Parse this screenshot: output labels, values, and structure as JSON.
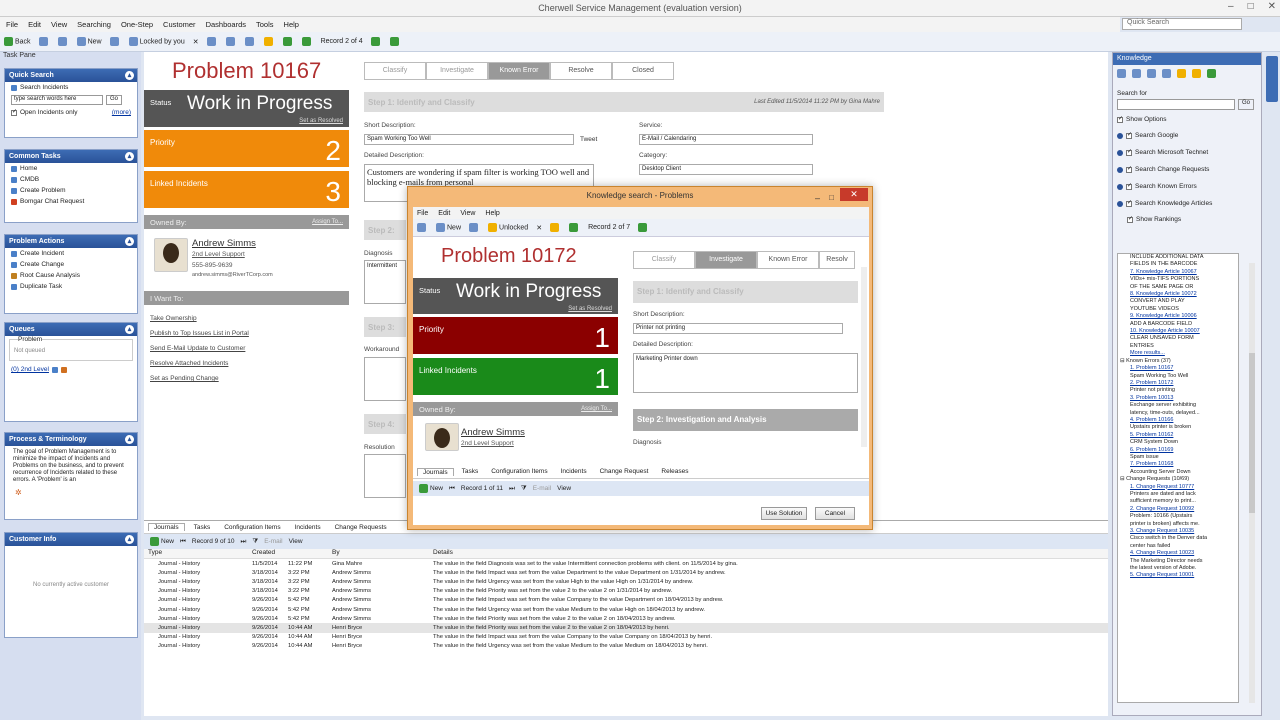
{
  "window": {
    "title": "Cherwell Service Management (evaluation version)",
    "quick_search_placeholder": "Quick Search"
  },
  "menu": [
    "File",
    "Edit",
    "View",
    "Searching",
    "One-Step",
    "Customer",
    "Dashboards",
    "Tools",
    "Help"
  ],
  "toolbar": {
    "back": "Back",
    "new": "New",
    "locked": "Locked by you",
    "record": "Record 2 of 4"
  },
  "task_pane": {
    "title": "Task Pane",
    "quick_search": {
      "header": "Quick Search",
      "label": "Search Incidents",
      "input": "type search words here",
      "go": "Go",
      "checkbox": "Open Incidents only",
      "more": "(more)"
    },
    "common_tasks": {
      "header": "Common Tasks",
      "items": [
        "Home",
        "CMDB",
        "Create Problem",
        "Bomgar Chat Request"
      ]
    },
    "problem_actions": {
      "header": "Problem Actions",
      "items": [
        "Create Incident",
        "Create Change",
        "Root Cause Analysis",
        "Duplicate Task"
      ]
    },
    "queues": {
      "header": "Queues",
      "label": "Problem",
      "placeholder": "Not queued",
      "link": "(0) 2nd Level"
    },
    "process": {
      "header": "Process & Terminology",
      "text": "The goal of Problem Management is to minimize the impact of Incidents and Problems on the business, and to prevent recurrence of Incidents related to these errors. A 'Problem' is an"
    },
    "customer": {
      "header": "Customer Info",
      "text": "No currently active customer"
    }
  },
  "record": {
    "title": "Problem  10167",
    "status_label": "Status",
    "status": "Work in Progress",
    "set_resolved": "Set as Resolved",
    "priority_label": "Priority",
    "priority": "2",
    "linked_label": "Linked Incidents",
    "linked": "3",
    "owned_label": "Owned By:",
    "assign": "Assign To...",
    "owner_name": "Andrew Simms",
    "owner_team": "2nd Level Support",
    "owner_phone": "555-895-9639",
    "owner_email": "andrew.simms@RiverTCorp.com",
    "i_want": "I Want To:",
    "actions": [
      "Take Ownership",
      "Publish to Top Issues List in Portal",
      "Send E-Mail Update to Customer",
      "Resolve Attached Incidents",
      "Set as Pending Change"
    ],
    "steps": [
      "Classify",
      "Investigate",
      "Known Error",
      "Resolve",
      "Closed"
    ],
    "step1": "Step 1: Identify and Classify",
    "last_edited": "Last Edited 11/5/2014 11:22 PM by Gina Mahre",
    "short_desc_label": "Short Description:",
    "short_desc": "Spam Working Too Well",
    "tweet": "Tweet",
    "service_label": "Service:",
    "service": "E-Mail / Calendaring",
    "detailed_label": "Detailed Description:",
    "detailed": "Customers are wondering if spam filter is working TOO well and blocking e-mails from personal",
    "category_label": "Category:",
    "category": "Desktop Client",
    "step2": "Step 2:",
    "diagnosis_label": "Diagnosis",
    "diagnosis": "Intermittent",
    "step3": "Step 3:",
    "workaround_label": "Workaround",
    "step4": "Step 4:",
    "resolution_label": "Resolution"
  },
  "bottom": {
    "tabs": [
      "Journals",
      "Tasks",
      "Configuration Items",
      "Incidents",
      "Change Requests"
    ],
    "new": "New",
    "record": "Record 9 of 10",
    "email": "E-mail",
    "view": "View",
    "columns": [
      "Type",
      "Created",
      "By",
      "Details"
    ],
    "rows": [
      [
        "Journal - History",
        "11/5/2014",
        "11:22 PM",
        "Gina Mahre",
        "The value in the field Diagnosis was set to the value Intermittent connection problems with client. on 11/5/2014 by gina."
      ],
      [
        "Journal - History",
        "3/18/2014",
        "3:22 PM",
        "Andrew Simms",
        "The value in the field Impact was set from the value Department to the value Department on 1/31/2014 by andrew."
      ],
      [
        "Journal - History",
        "3/18/2014",
        "3:22 PM",
        "Andrew Simms",
        "The value in the field Urgency was set from the value High to the value High on 1/31/2014 by andrew."
      ],
      [
        "Journal - History",
        "3/18/2014",
        "3:22 PM",
        "Andrew Simms",
        "The value in the field Priority was set from the value 2 to the value 2 on 1/31/2014 by andrew."
      ],
      [
        "Journal - History",
        "9/26/2014",
        "5:42 PM",
        "Andrew Simms",
        "The value in the field Impact was set from the value Company to the value Department on 18/04/2013 by andrew."
      ],
      [
        "Journal - History",
        "9/26/2014",
        "5:42 PM",
        "Andrew Simms",
        "The value in the field Urgency was set from the value Medium to the value High on 18/04/2013 by andrew."
      ],
      [
        "Journal - History",
        "9/26/2014",
        "5:42 PM",
        "Andrew Simms",
        "The value in the field Priority was set from the value 2 to the value 2 on 18/04/2013 by andrew."
      ],
      [
        "Journal - History",
        "9/26/2014",
        "10:44 AM",
        "Henri Bryce",
        "The value in the field Priority was set from the value 2 to the value 2 on 18/04/2013 by henri."
      ],
      [
        "Journal - History",
        "9/26/2014",
        "10:44 AM",
        "Henri Bryce",
        "The value in the field Impact was set from the value Company to the value Company on 18/04/2013 by henri."
      ],
      [
        "Journal - History",
        "9/26/2014",
        "10:44 AM",
        "Henri Bryce",
        "The value in the field Urgency was set from the value Medium to the value Medium on 18/04/2013 by henri."
      ]
    ]
  },
  "knowledge": {
    "header": "Knowledge",
    "search_for": "Search for",
    "go": "Go",
    "show_options": "Show Options",
    "options": [
      "Search Google",
      "Search Microsoft Technet",
      "Search Change Requests",
      "Search Known Errors",
      "Search Knowledge Articles",
      "Show Rankings"
    ],
    "lines": [
      {
        "t": "INCLUDE ADDITIONAL DATA",
        "s": ""
      },
      {
        "t": "FIELDS IN THE BARCODE",
        "s": ""
      },
      {
        "t": "7. Knowledge Article 10067",
        "s": "u"
      },
      {
        "t": "VIDs+ mis-TIFS PORTIONS",
        "s": ""
      },
      {
        "t": "OF THE SAME PAGE OR",
        "s": ""
      },
      {
        "t": "8. Knowledge Article 10072",
        "s": "u"
      },
      {
        "t": "CONVERT AND PLAY",
        "s": ""
      },
      {
        "t": "YOUTUBE VIDEOS",
        "s": ""
      },
      {
        "t": "9. Knowledge Article 10006",
        "s": "u"
      },
      {
        "t": "ADD A BARCODE FIELD",
        "s": ""
      },
      {
        "t": "10. Knowledge Article 10007",
        "s": "u"
      },
      {
        "t": "CLEAR UNSAVED FORM",
        "s": ""
      },
      {
        "t": "ENTRIES",
        "s": ""
      },
      {
        "t": "More results...",
        "s": "u"
      },
      {
        "t": "⊟ Known Errors (37)",
        "s": "g"
      },
      {
        "t": "1. Problem 10167",
        "s": "u"
      },
      {
        "t": "Spam Working Too Well",
        "s": ""
      },
      {
        "t": "2. Problem 10172",
        "s": "u"
      },
      {
        "t": "Printer not printing",
        "s": ""
      },
      {
        "t": "3. Problem 10013",
        "s": "u"
      },
      {
        "t": "Exchange server exhibiting",
        "s": ""
      },
      {
        "t": "latency, time-outs, delayed...",
        "s": ""
      },
      {
        "t": "4. Problem 10166",
        "s": "u"
      },
      {
        "t": "Upstairs printer is broken",
        "s": ""
      },
      {
        "t": "5. Problem 10162",
        "s": "u"
      },
      {
        "t": "CRM System Down",
        "s": ""
      },
      {
        "t": "6. Problem 10169",
        "s": "u"
      },
      {
        "t": "Spam issue",
        "s": ""
      },
      {
        "t": "7. Problem 10168",
        "s": "u"
      },
      {
        "t": "Accounting Server Down",
        "s": ""
      },
      {
        "t": "⊟ Change Requests (10/69)",
        "s": "g"
      },
      {
        "t": "1. Change Request 10777",
        "s": "u"
      },
      {
        "t": "Printers are dated and lack",
        "s": ""
      },
      {
        "t": "sufficient memory to print...",
        "s": ""
      },
      {
        "t": "2. Change Request 10092",
        "s": "u"
      },
      {
        "t": "Problem: 10166 (Upstairs",
        "s": ""
      },
      {
        "t": "printer is broken) affects me.",
        "s": ""
      },
      {
        "t": "3. Change Request 10035",
        "s": "u"
      },
      {
        "t": "Cisco switch in the Denver data",
        "s": ""
      },
      {
        "t": "center has failed",
        "s": ""
      },
      {
        "t": "4. Change Request 10023",
        "s": "u"
      },
      {
        "t": "The Marketing Director needs",
        "s": ""
      },
      {
        "t": "the latest version of Adobe.",
        "s": ""
      },
      {
        "t": "5. Change Request 10001",
        "s": "u"
      }
    ]
  },
  "dialog": {
    "title": "Knowledge search - Problems",
    "menu": [
      "File",
      "Edit",
      "View",
      "Help"
    ],
    "toolbar": {
      "new": "New",
      "unlocked": "Unlocked",
      "record": "Record 2 of 7"
    },
    "record": {
      "title": "Problem  10172",
      "status_label": "Status",
      "status": "Work in Progress",
      "set_resolved": "Set as Resolved",
      "priority_label": "Priority",
      "priority": "1",
      "linked_label": "Linked Incidents",
      "linked": "1",
      "owned_label": "Owned By:",
      "assign": "Assign To...",
      "owner_name": "Andrew Simms",
      "owner_team": "2nd Level Support",
      "steps": [
        "Classify",
        "Investigate",
        "Known Error",
        "Resolv"
      ],
      "step1": "Step 1: Identify and Classify",
      "short_desc_label": "Short Description:",
      "short_desc": "Printer not printing",
      "detailed_label": "Detailed Description:",
      "detailed": "Marketing Printer down",
      "step2": "Step 2: Investigation and Analysis",
      "diagnosis_label": "Diagnosis"
    },
    "tabs": [
      "Journals",
      "Tasks",
      "Configuration Items",
      "Incidents",
      "Change Request",
      "Releases"
    ],
    "bottom_toolbar": {
      "new": "New",
      "record": "Record 1 of 11",
      "email": "E-mail",
      "view": "View"
    },
    "use_solution": "Use Solution",
    "cancel": "Cancel"
  },
  "colors": {
    "priority2": "#f08a0a",
    "linked3": "#f08a0a",
    "priority1": "#8b0000",
    "linked1": "#1a8a1a",
    "status_bg": "#555555",
    "header_blue": "#2a5298",
    "dialog_border": "#f4b978"
  }
}
